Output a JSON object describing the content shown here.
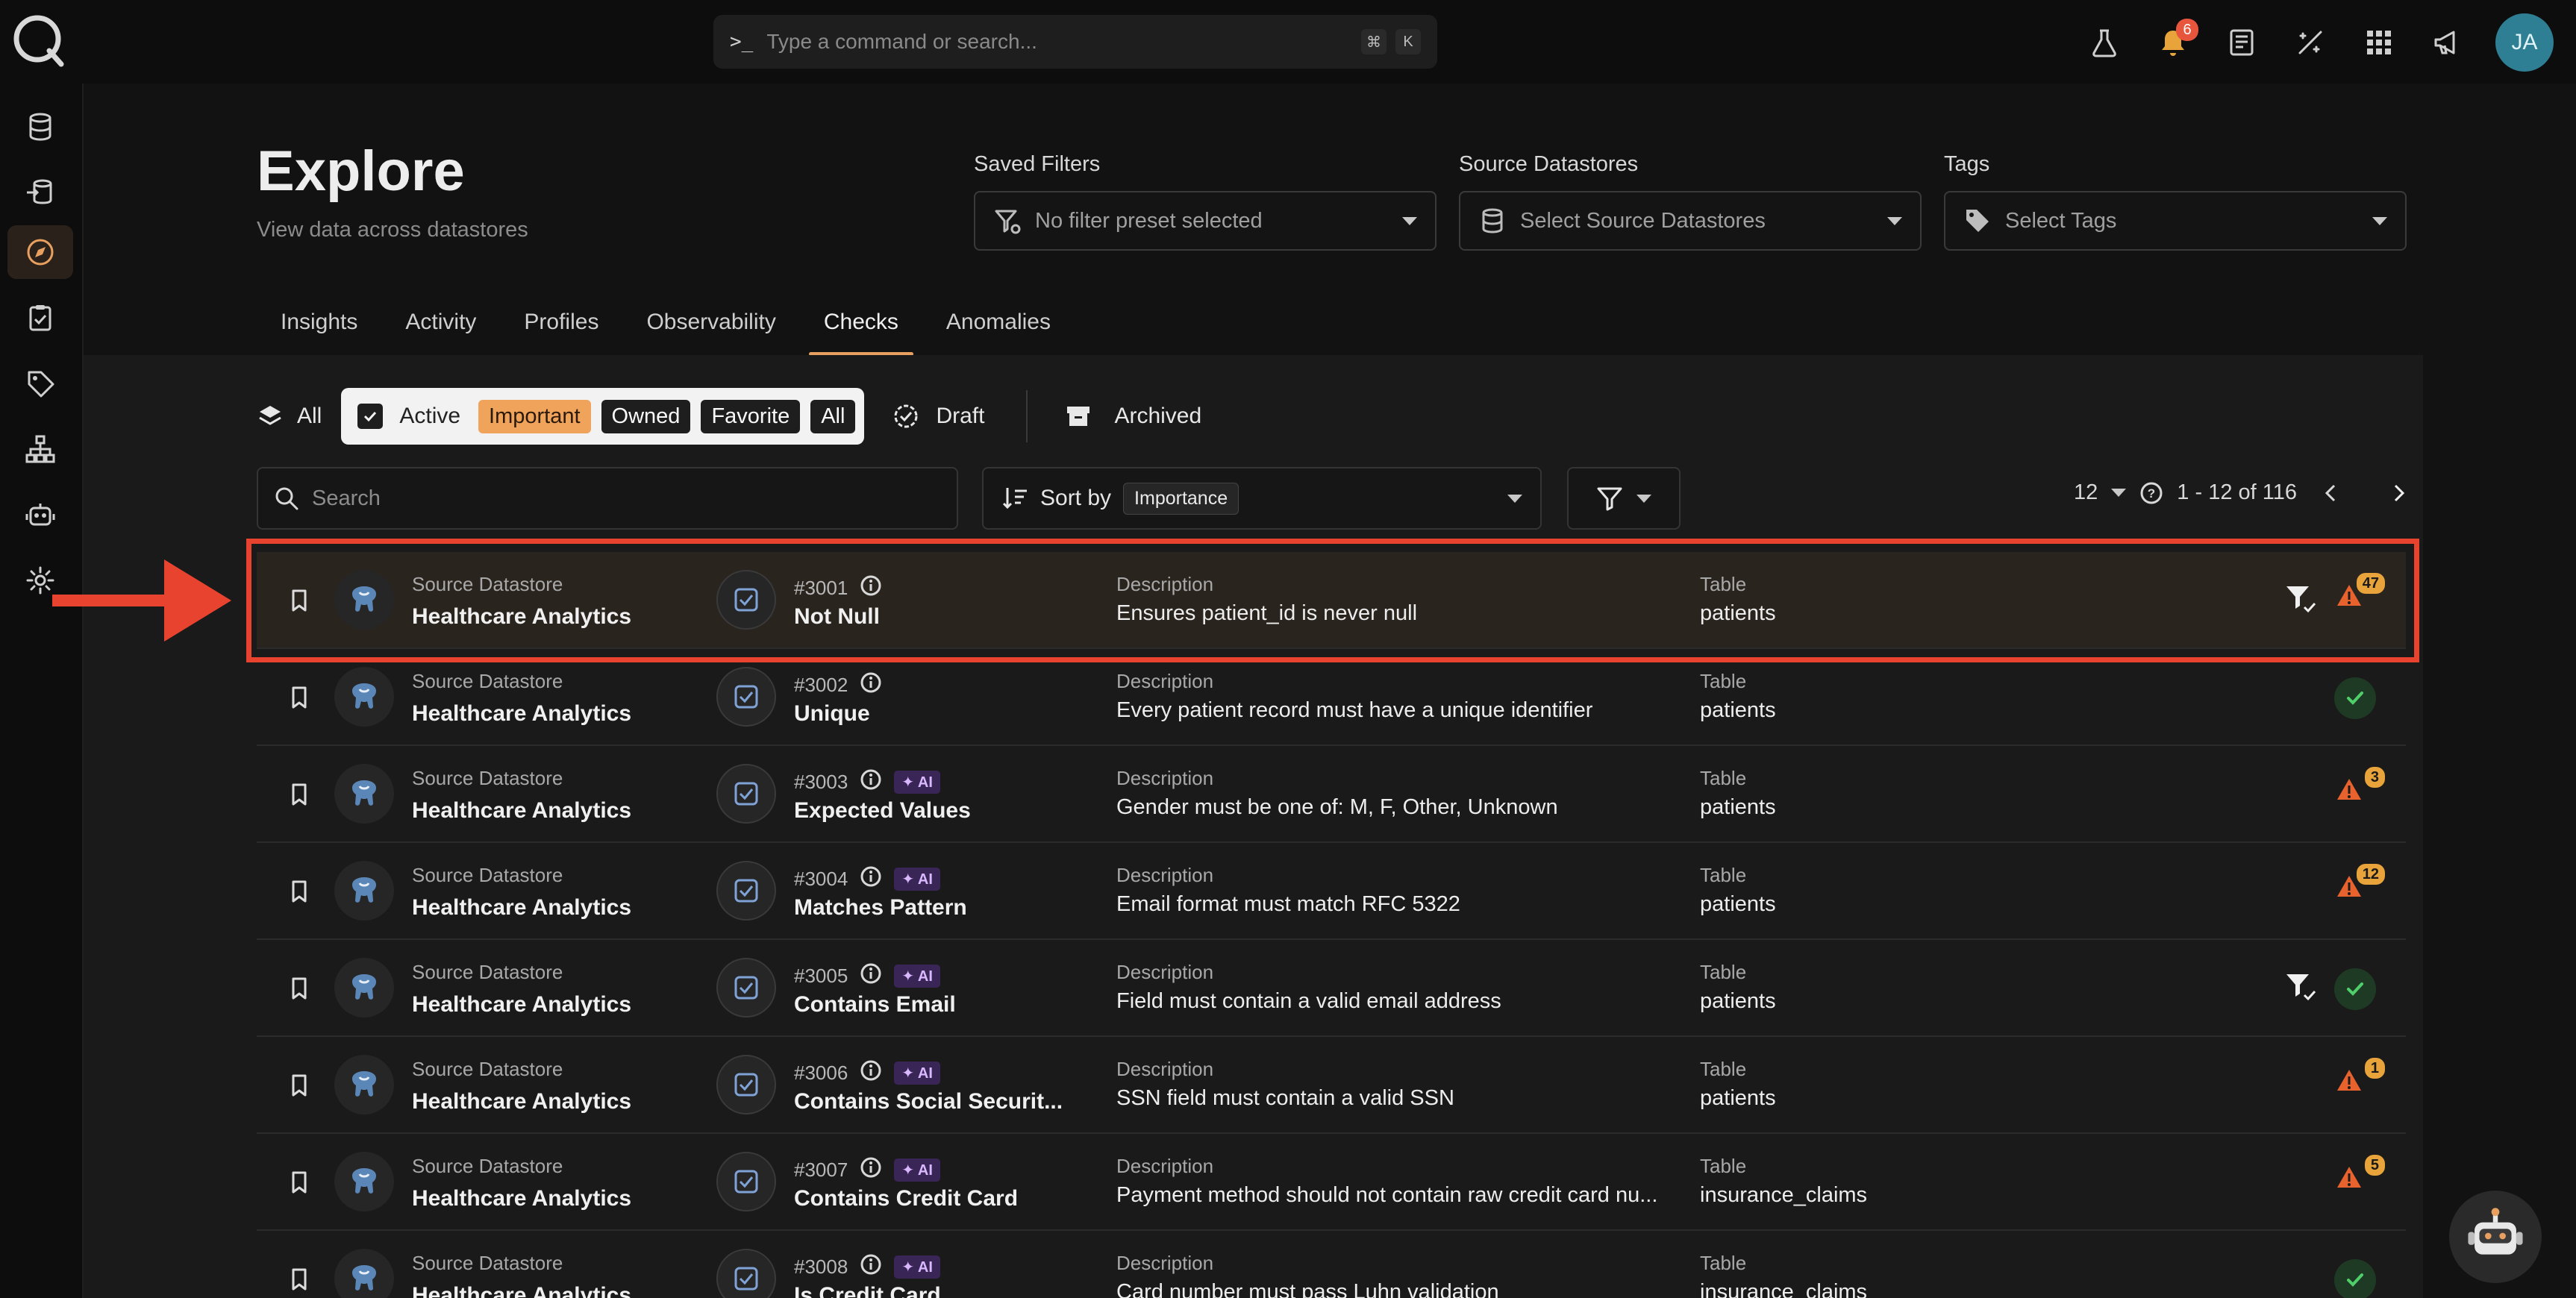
{
  "search_bar": {
    "prompt": ">_",
    "placeholder": "Type a command or search...",
    "key1": "⌘",
    "key2": "K"
  },
  "topbar": {
    "notifications": "6",
    "avatar": "JA"
  },
  "page": {
    "title": "Explore",
    "subtitle": "View data across datastores"
  },
  "filters": {
    "saved": {
      "label": "Saved Filters",
      "value": "No filter preset selected"
    },
    "datastores": {
      "label": "Source Datastores",
      "value": "Select Source Datastores"
    },
    "tags": {
      "label": "Tags",
      "value": "Select Tags"
    }
  },
  "tabs": [
    "Insights",
    "Activity",
    "Profiles",
    "Observability",
    "Checks",
    "Anomalies"
  ],
  "active_tab": "Checks",
  "segments": {
    "all": "All",
    "active": "Active",
    "important": "Important",
    "owned": "Owned",
    "favorite": "Favorite",
    "all2": "All",
    "draft": "Draft",
    "archived": "Archived"
  },
  "list_controls": {
    "search_placeholder": "Search",
    "sort_label": "Sort by",
    "sort_value": "Importance",
    "page_size": "12",
    "range": "1 - 12 of 116"
  },
  "labels": {
    "source": "Source Datastore",
    "description": "Description",
    "table": "Table"
  },
  "rows": [
    {
      "datastore": "Healthcare Analytics",
      "id": "#3001",
      "ai": false,
      "name": "Not Null",
      "description": "Ensures patient_id is never null",
      "table": "patients",
      "status": "warn",
      "count": "47",
      "filter": true
    },
    {
      "datastore": "Healthcare Analytics",
      "id": "#3002",
      "ai": false,
      "name": "Unique",
      "description": "Every patient record must have a unique identifier",
      "table": "patients",
      "status": "ok",
      "count": "",
      "filter": false
    },
    {
      "datastore": "Healthcare Analytics",
      "id": "#3003",
      "ai": true,
      "name": "Expected Values",
      "description": "Gender must be one of: M, F, Other, Unknown",
      "table": "patients",
      "status": "warn",
      "count": "3",
      "filter": false
    },
    {
      "datastore": "Healthcare Analytics",
      "id": "#3004",
      "ai": true,
      "name": "Matches Pattern",
      "description": "Email format must match RFC 5322",
      "table": "patients",
      "status": "warn",
      "count": "12",
      "filter": false
    },
    {
      "datastore": "Healthcare Analytics",
      "id": "#3005",
      "ai": true,
      "name": "Contains Email",
      "description": "Field must contain a valid email address",
      "table": "patients",
      "status": "ok",
      "count": "",
      "filter": true
    },
    {
      "datastore": "Healthcare Analytics",
      "id": "#3006",
      "ai": true,
      "name": "Contains Social Securit...",
      "description": "SSN field must contain a valid SSN",
      "table": "patients",
      "status": "warn",
      "count": "1",
      "filter": false
    },
    {
      "datastore": "Healthcare Analytics",
      "id": "#3007",
      "ai": true,
      "name": "Contains Credit Card",
      "description": "Payment method should not contain raw credit card nu...",
      "table": "insurance_claims",
      "status": "warn",
      "count": "5",
      "filter": false
    },
    {
      "datastore": "Healthcare Analytics",
      "id": "#3008",
      "ai": true,
      "name": "Is Credit Card",
      "description": "Card number must pass Luhn validation",
      "table": "insurance_claims",
      "status": "ok",
      "count": "",
      "filter": false
    }
  ],
  "ai_label": "✦ AI",
  "colors": {
    "accent": "#e8a060",
    "highlight": "#e8432e",
    "warn": "#e8a43a",
    "ok": "#3fbf5a"
  }
}
